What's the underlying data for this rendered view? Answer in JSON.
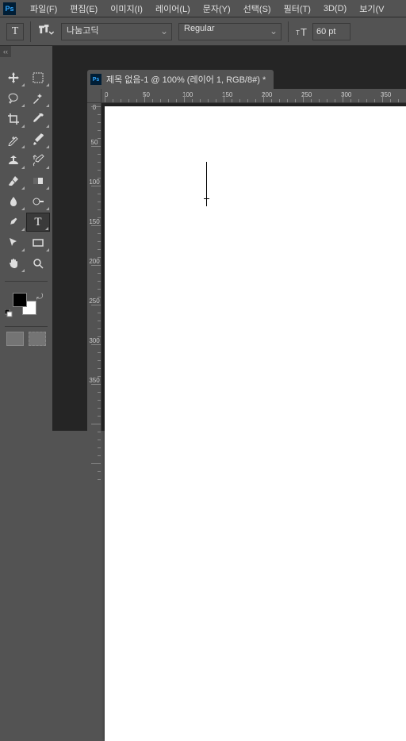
{
  "menu": {
    "items": [
      "파일(F)",
      "편집(E)",
      "이미지(I)",
      "레이어(L)",
      "문자(Y)",
      "선택(S)",
      "필터(T)",
      "3D(D)",
      "보기(V"
    ]
  },
  "options": {
    "tool_letter": "T",
    "font_family": "나눔고딕",
    "font_style": "Regular",
    "font_size": "60 pt"
  },
  "document": {
    "title": "제목 없음-1 @ 100% (레이어 1, RGB/8#) *"
  },
  "ruler": {
    "h": [
      "0",
      "50",
      "100",
      "150",
      "200",
      "250",
      "300",
      "350"
    ],
    "v": [
      "0",
      "50",
      "100",
      "150",
      "200",
      "250",
      "300",
      "350"
    ]
  },
  "tools": {
    "move": "move-tool",
    "marquee": "marquee-tool",
    "lasso": "lasso-tool",
    "magicwand": "magic-wand-tool",
    "crop": "crop-tool",
    "eyedropper": "eyedropper-tool",
    "heal": "healing-brush-tool",
    "brush": "brush-tool",
    "stamp": "clone-stamp-tool",
    "history": "history-brush-tool",
    "eraser": "eraser-tool",
    "gradient": "gradient-tool",
    "blur": "blur-tool",
    "dodge": "dodge-tool",
    "pen": "pen-tool",
    "type": "type-tool",
    "path": "path-select-tool",
    "shape": "rectangle-tool",
    "hand": "hand-tool",
    "zoom": "zoom-tool"
  },
  "colors": {
    "fg": "#000000",
    "bg": "#ffffff"
  }
}
